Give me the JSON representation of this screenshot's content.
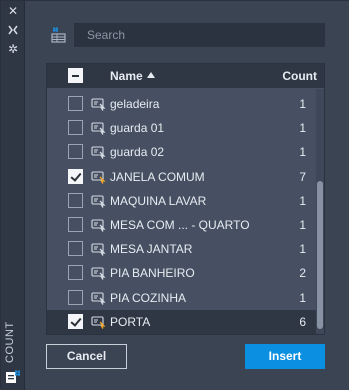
{
  "strip": {
    "title": "COUNT",
    "icons": [
      "close-icon",
      "collapse-icon",
      "settings-icon",
      "count-palette-icon"
    ]
  },
  "search": {
    "placeholder": "Search"
  },
  "list": {
    "columns": {
      "name": "Name",
      "count": "Count"
    },
    "sort": "ascending",
    "rows": [
      {
        "name": "geladeira",
        "count": "1",
        "checked": false,
        "selected": false
      },
      {
        "name": "guarda 01",
        "count": "1",
        "checked": false,
        "selected": false
      },
      {
        "name": "guarda 02",
        "count": "1",
        "checked": false,
        "selected": false
      },
      {
        "name": "JANELA COMUM",
        "count": "7",
        "checked": true,
        "selected": false
      },
      {
        "name": "MAQUINA LAVAR",
        "count": "1",
        "checked": false,
        "selected": false
      },
      {
        "name": "MESA COM ... - QUARTO",
        "count": "1",
        "checked": false,
        "selected": false
      },
      {
        "name": "MESA JANTAR",
        "count": "1",
        "checked": false,
        "selected": false
      },
      {
        "name": "PIA BANHEIRO",
        "count": "2",
        "checked": false,
        "selected": false
      },
      {
        "name": "PIA COZINHA",
        "count": "1",
        "checked": false,
        "selected": false
      },
      {
        "name": "PORTA",
        "count": "6",
        "checked": true,
        "selected": true
      }
    ]
  },
  "buttons": {
    "cancel": "Cancel",
    "insert": "Insert"
  },
  "colors": {
    "accent": "#0b8fe0",
    "panel": "#3b4453",
    "list_bg": "#465062",
    "icon_highlight": "#f5a623"
  }
}
